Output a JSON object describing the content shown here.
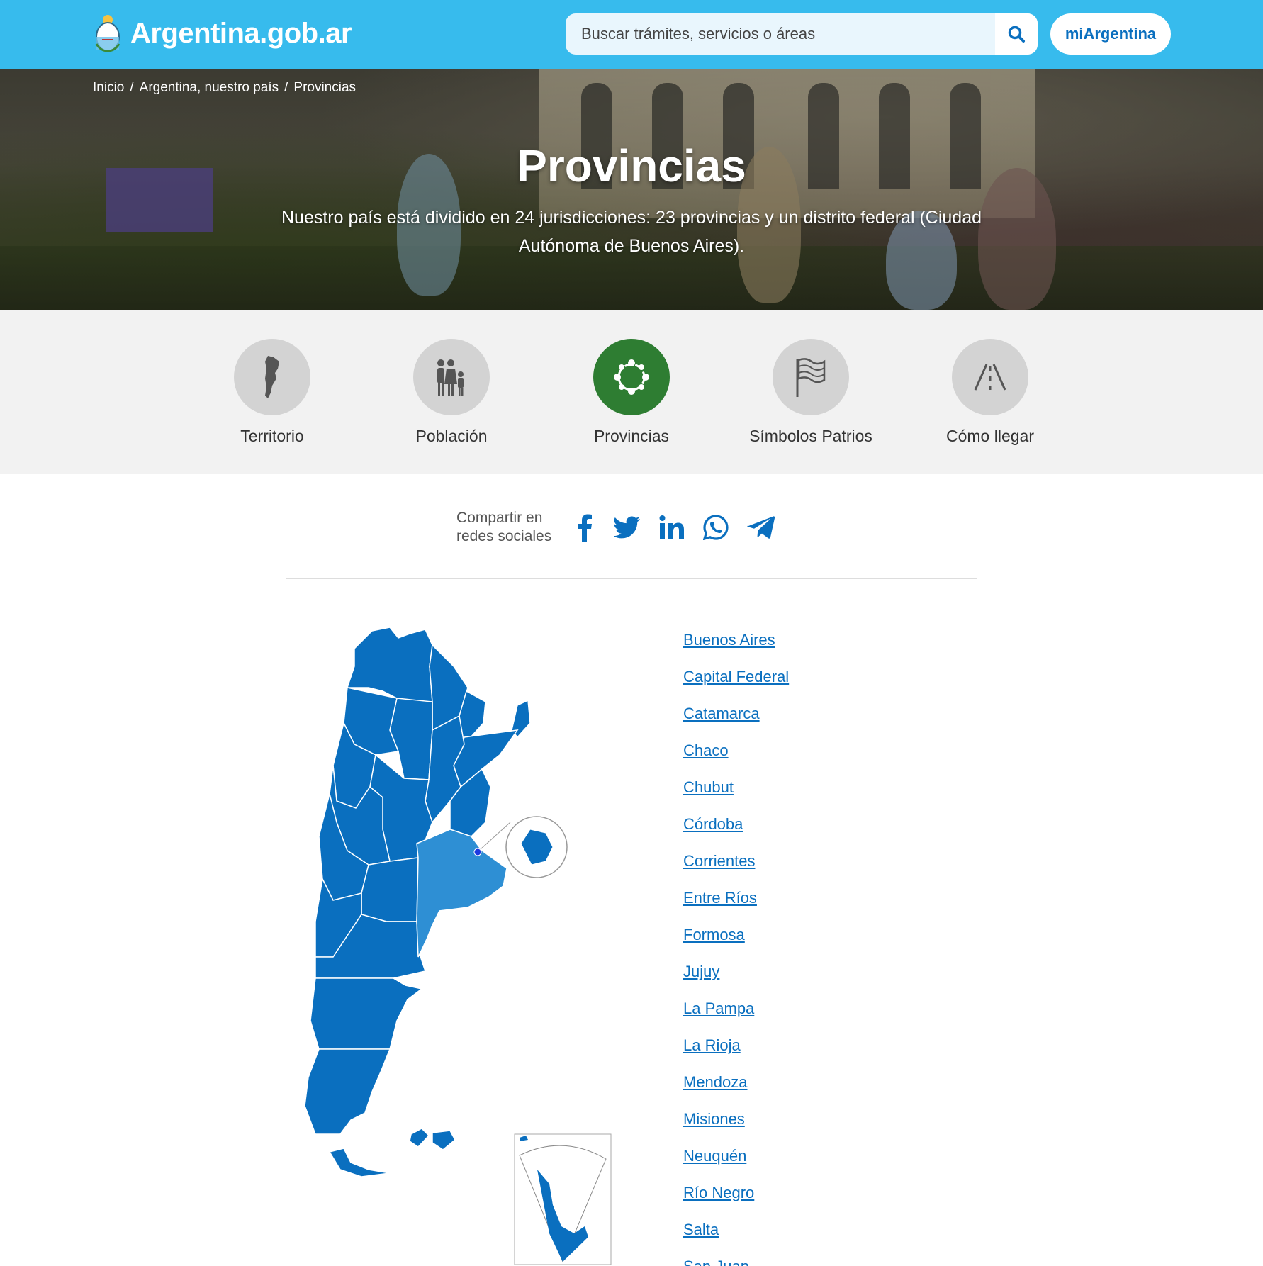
{
  "header": {
    "brand": "Argentina.gob.ar",
    "search_placeholder": "Buscar trámites, servicios o áreas",
    "mi_button": "miArgentina",
    "bg_color": "#37bbed"
  },
  "breadcrumb": [
    "Inicio",
    "Argentina, nuestro país",
    "Provincias"
  ],
  "hero": {
    "title": "Provincias",
    "subtitle_line1": "Nuestro país está dividido en 24 jurisdicciones: 23 provincias y un distrito federal (Ciudad",
    "subtitle_line2": "Autónoma de Buenos Aires)."
  },
  "nav": [
    {
      "label": "Territorio",
      "icon": "map-silhouette-icon",
      "active": false
    },
    {
      "label": "Población",
      "icon": "family-icon",
      "active": false
    },
    {
      "label": "Provincias",
      "icon": "network-circle-icon",
      "active": true
    },
    {
      "label": "Símbolos Patrios",
      "icon": "flag-icon",
      "active": false
    },
    {
      "label": "Cómo llegar",
      "icon": "road-icon",
      "active": false
    }
  ],
  "share": {
    "line1": "Compartir en",
    "line2": "redes sociales",
    "networks": [
      "facebook-icon",
      "twitter-icon",
      "linkedin-icon",
      "whatsapp-icon",
      "telegram-icon"
    ],
    "icon_color": "#0a6fbf"
  },
  "provinces": [
    "Buenos Aires",
    "Capital Federal",
    "Catamarca",
    "Chaco",
    "Chubut",
    "Córdoba",
    "Corrientes",
    "Entre Ríos",
    "Formosa",
    "Jujuy",
    "La Pampa",
    "La Rioja",
    "Mendoza",
    "Misiones",
    "Neuquén",
    "Río Negro",
    "Salta",
    "San Juan"
  ],
  "map_colors": {
    "default": "#0a6fbf",
    "highlight": "#2e8fd4"
  }
}
